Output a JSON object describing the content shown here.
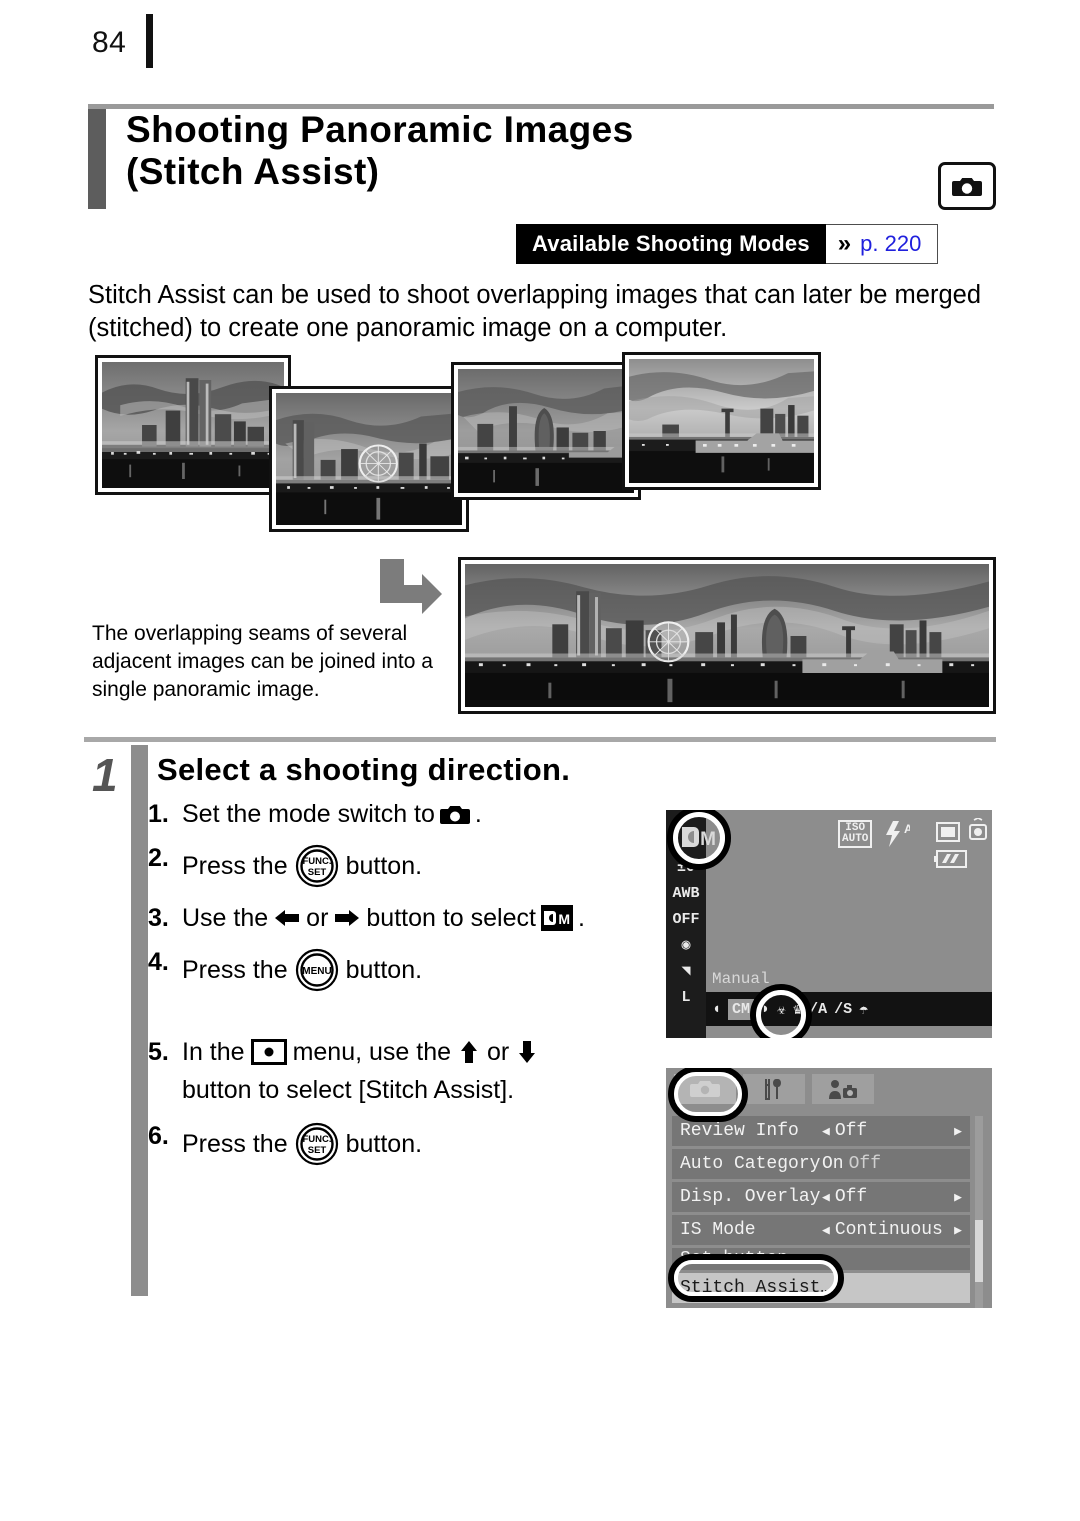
{
  "page": {
    "number": "84"
  },
  "header": {
    "title_line1": "Shooting Panoramic Images",
    "title_line2": "(Stitch Assist)",
    "mode_icon": "camera-icon"
  },
  "available_modes": {
    "label": "Available Shooting Modes",
    "chevron": "»",
    "page_ref": "p. 220",
    "page_ref_color": "#2020dd"
  },
  "intro": "Stitch Assist can be used to shoot overlapping images that can later be merged (stitched) to create one panoramic image on a computer.",
  "montage": {
    "alt": "four overlapping grayscale night cityscape photographs",
    "count": 4
  },
  "panorama": {
    "arrow_icon": "merge-arrow-icon",
    "caption": "The overlapping seams of several adjacent images can be joined into a single panoramic image.",
    "alt": "merged panoramic night cityscape photograph"
  },
  "step": {
    "number": "1",
    "title": "Select a shooting direction.",
    "items": [
      {
        "n": "1.",
        "pre": "Set the mode switch to",
        "icon": "camera-icon",
        "post": "."
      },
      {
        "n": "2.",
        "pre": "Press the",
        "icon": "func-set-button-icon",
        "post": "button."
      },
      {
        "n": "3.",
        "pre": "Use the",
        "icon": "left-arrow-icon",
        "mid": "or",
        "icon2": "right-arrow-icon",
        "mid2": "button to select",
        "icon3": "stitch-assist-mode-icon",
        "post": "."
      },
      {
        "n": "4.",
        "pre": "Press the",
        "icon": "menu-button-icon",
        "post": "button."
      },
      {
        "n": "5.",
        "pre": "In the",
        "icon": "rec-menu-icon",
        "mid": "menu, use the",
        "icon2": "up-arrow-icon",
        "mid2": "or",
        "icon3": "down-arrow-icon",
        "wrap": "button to select [Stitch Assist]."
      },
      {
        "n": "6.",
        "pre": "Press the",
        "icon": "func-set-button-icon",
        "post": "button."
      }
    ],
    "button_labels": {
      "func": "FUNC.",
      "set": "SET",
      "menu": "MENU"
    }
  },
  "lcd_func": {
    "selected_mode": "CM",
    "mode_name": "Manual",
    "left_column": [
      "±0",
      "AWB",
      "OFF",
      "◉",
      "◥",
      "L"
    ],
    "top_icons": [
      "ISO AUTO",
      "flash-auto-icon",
      "single-shot-icon",
      "camera-shake-icon",
      "battery-icon"
    ],
    "mode_row": [
      "CM",
      "◐",
      "◑",
      "⚘",
      "❄",
      "A",
      "S",
      "☃"
    ],
    "highlight": "circle-highlight"
  },
  "lcd_menu": {
    "tabs": [
      {
        "icon": "rec-tab-icon",
        "selected": true
      },
      {
        "icon": "setup-tab-icon",
        "selected": false
      },
      {
        "icon": "my-camera-tab-icon",
        "selected": false
      }
    ],
    "rows": [
      {
        "label": "Review Info",
        "value": "Off",
        "left_caret": true,
        "right_caret": true
      },
      {
        "label": "Auto Category",
        "value": "On",
        "value2": "Off",
        "left_caret": false,
        "right_caret": false
      },
      {
        "label": "Disp. Overlay",
        "value": "Off",
        "left_caret": true,
        "right_caret": true
      },
      {
        "label": "IS Mode",
        "value": "Continuous",
        "left_caret": true,
        "right_caret": true
      },
      {
        "label": "Set  button",
        "value": "",
        "left_caret": false,
        "right_caret": false,
        "partial": true
      },
      {
        "label": "Stitch Assist…",
        "value": "",
        "highlighted": true
      }
    ]
  },
  "colors": {
    "title_bar": "#5d5d5d",
    "gutter": "#8d8d8d",
    "rule": "#a8a8a8",
    "lcd_bg": "#8d8d8d",
    "link": "#2020dd"
  }
}
